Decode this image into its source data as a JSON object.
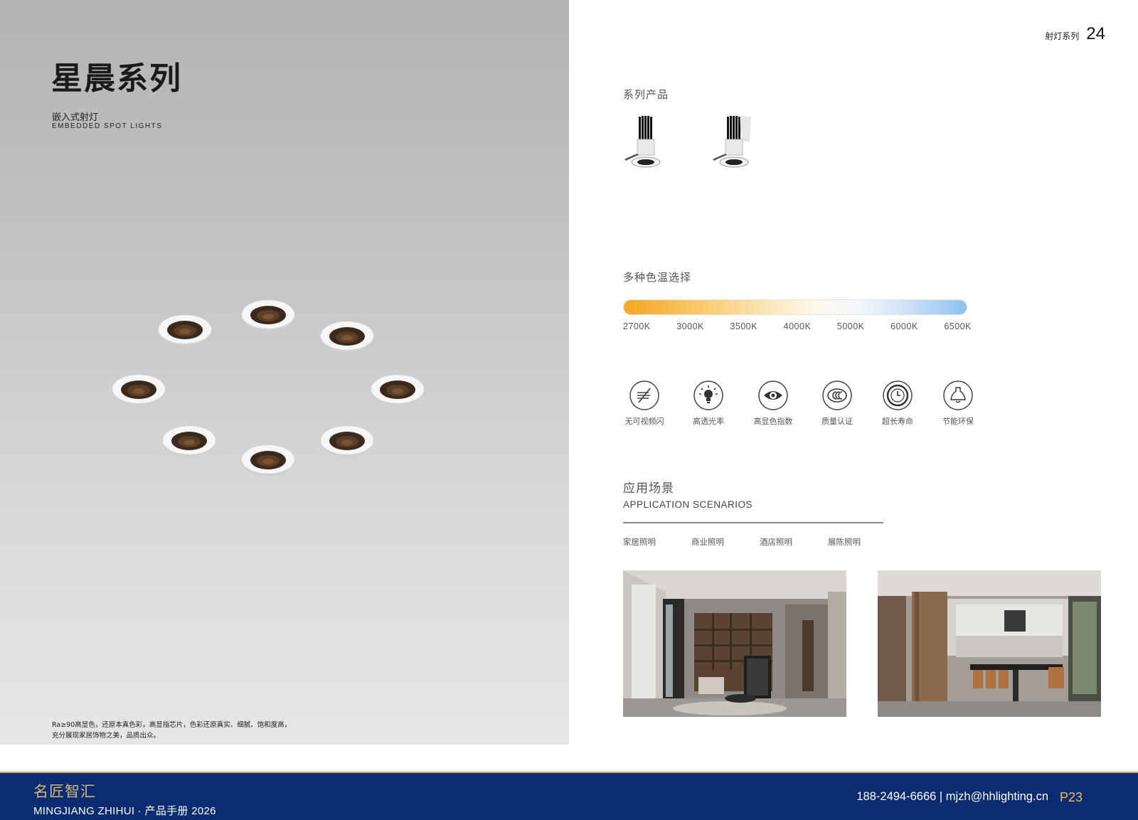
{
  "hero": {
    "title": "星晨系列",
    "subtitle_cn": "嵌入式射灯",
    "subtitle_en": "EMBEDDED SPOT LIGHTS",
    "description": [
      "Ra≥90高显色，还原本真色彩，高显指芯片，色彩还原真实、细腻、饱和度高，",
      "充分展现家居饰物之美，品质出众。"
    ]
  },
  "page_header": {
    "category": "射灯系列",
    "page_number": "24"
  },
  "series_products": {
    "label": "系列产品"
  },
  "color_temperature": {
    "label": "多种色温选择",
    "values": [
      "2700K",
      "3000K",
      "3500K",
      "4000K",
      "5000K",
      "6000K",
      "6500K"
    ]
  },
  "features": [
    {
      "label": "无可视频闪",
      "icon": "no-flicker-icon"
    },
    {
      "label": "高透光率",
      "icon": "light-bulb-icon"
    },
    {
      "label": "高显色指数",
      "icon": "eye-icon"
    },
    {
      "label": "质量认证",
      "icon": "ccc-certification-icon"
    },
    {
      "label": "超长寿命",
      "icon": "clock-icon"
    },
    {
      "label": "节能环保",
      "icon": "lamp-icon"
    }
  ],
  "application": {
    "title_cn": "应用场景",
    "title_en": "APPLICATION SCENARIOS",
    "tabs": [
      "家居照明",
      "商业照明",
      "酒店照明",
      "展陈照明"
    ]
  },
  "footer": {
    "brand": "名匠智汇",
    "subtitle": "MINGJIANG ZHIHUI  ·  产品手册 2026",
    "contact": "188-2494-6666   |   mjzh@hhlighting.cn",
    "page": "P23"
  }
}
